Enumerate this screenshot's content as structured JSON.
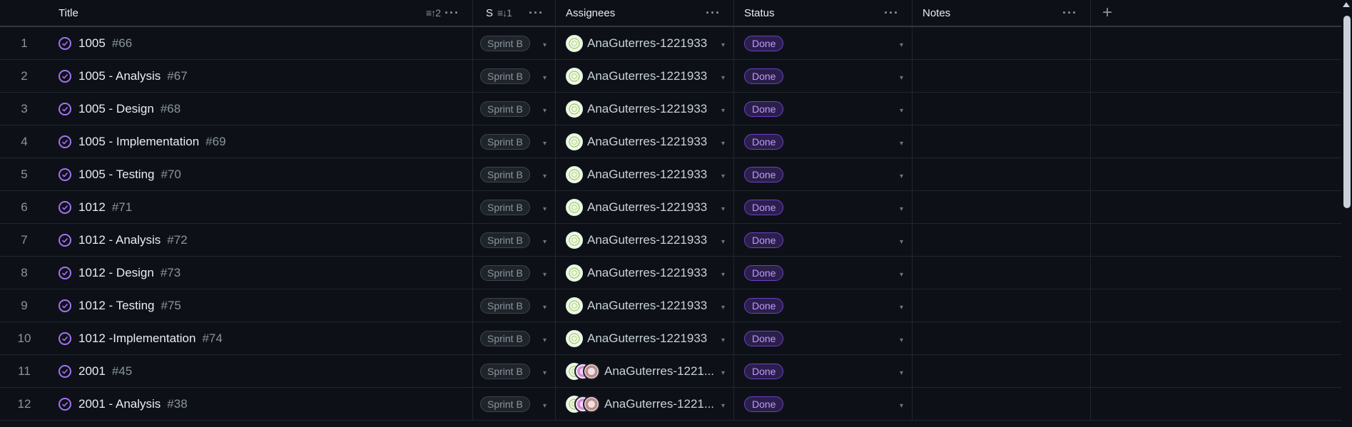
{
  "headers": {
    "title": "Title",
    "title_sort": "≡↑2",
    "sprint": "S",
    "sprint_sort": "≡↓1",
    "assignees": "Assignees",
    "status": "Status",
    "notes": "Notes",
    "more": "···",
    "add": "+"
  },
  "caret": "▾",
  "rows": [
    {
      "num": "1",
      "title": "1005",
      "issue": "#66",
      "sprint": "Sprint B",
      "assignee": "AnaGuterres-1221933",
      "multi": false,
      "status": "Done"
    },
    {
      "num": "2",
      "title": "1005 - Analysis",
      "issue": "#67",
      "sprint": "Sprint B",
      "assignee": "AnaGuterres-1221933",
      "multi": false,
      "status": "Done"
    },
    {
      "num": "3",
      "title": "1005 - Design",
      "issue": "#68",
      "sprint": "Sprint B",
      "assignee": "AnaGuterres-1221933",
      "multi": false,
      "status": "Done"
    },
    {
      "num": "4",
      "title": "1005 - Implementation",
      "issue": "#69",
      "sprint": "Sprint B",
      "assignee": "AnaGuterres-1221933",
      "multi": false,
      "status": "Done"
    },
    {
      "num": "5",
      "title": "1005 - Testing",
      "issue": "#70",
      "sprint": "Sprint B",
      "assignee": "AnaGuterres-1221933",
      "multi": false,
      "status": "Done"
    },
    {
      "num": "6",
      "title": "1012",
      "issue": "#71",
      "sprint": "Sprint B",
      "assignee": "AnaGuterres-1221933",
      "multi": false,
      "status": "Done"
    },
    {
      "num": "7",
      "title": "1012 - Analysis",
      "issue": "#72",
      "sprint": "Sprint B",
      "assignee": "AnaGuterres-1221933",
      "multi": false,
      "status": "Done"
    },
    {
      "num": "8",
      "title": "1012 - Design",
      "issue": "#73",
      "sprint": "Sprint B",
      "assignee": "AnaGuterres-1221933",
      "multi": false,
      "status": "Done"
    },
    {
      "num": "9",
      "title": "1012 - Testing",
      "issue": "#75",
      "sprint": "Sprint B",
      "assignee": "AnaGuterres-1221933",
      "multi": false,
      "status": "Done"
    },
    {
      "num": "10",
      "title": "1012 -Implementation",
      "issue": "#74",
      "sprint": "Sprint B",
      "assignee": "AnaGuterres-1221933",
      "multi": false,
      "status": "Done"
    },
    {
      "num": "11",
      "title": "2001",
      "issue": "#45",
      "sprint": "Sprint B",
      "assignee": "AnaGuterres-1221...",
      "multi": true,
      "status": "Done"
    },
    {
      "num": "12",
      "title": "2001 - Analysis",
      "issue": "#38",
      "sprint": "Sprint B",
      "assignee": "AnaGuterres-1221...",
      "multi": true,
      "status": "Done"
    }
  ]
}
